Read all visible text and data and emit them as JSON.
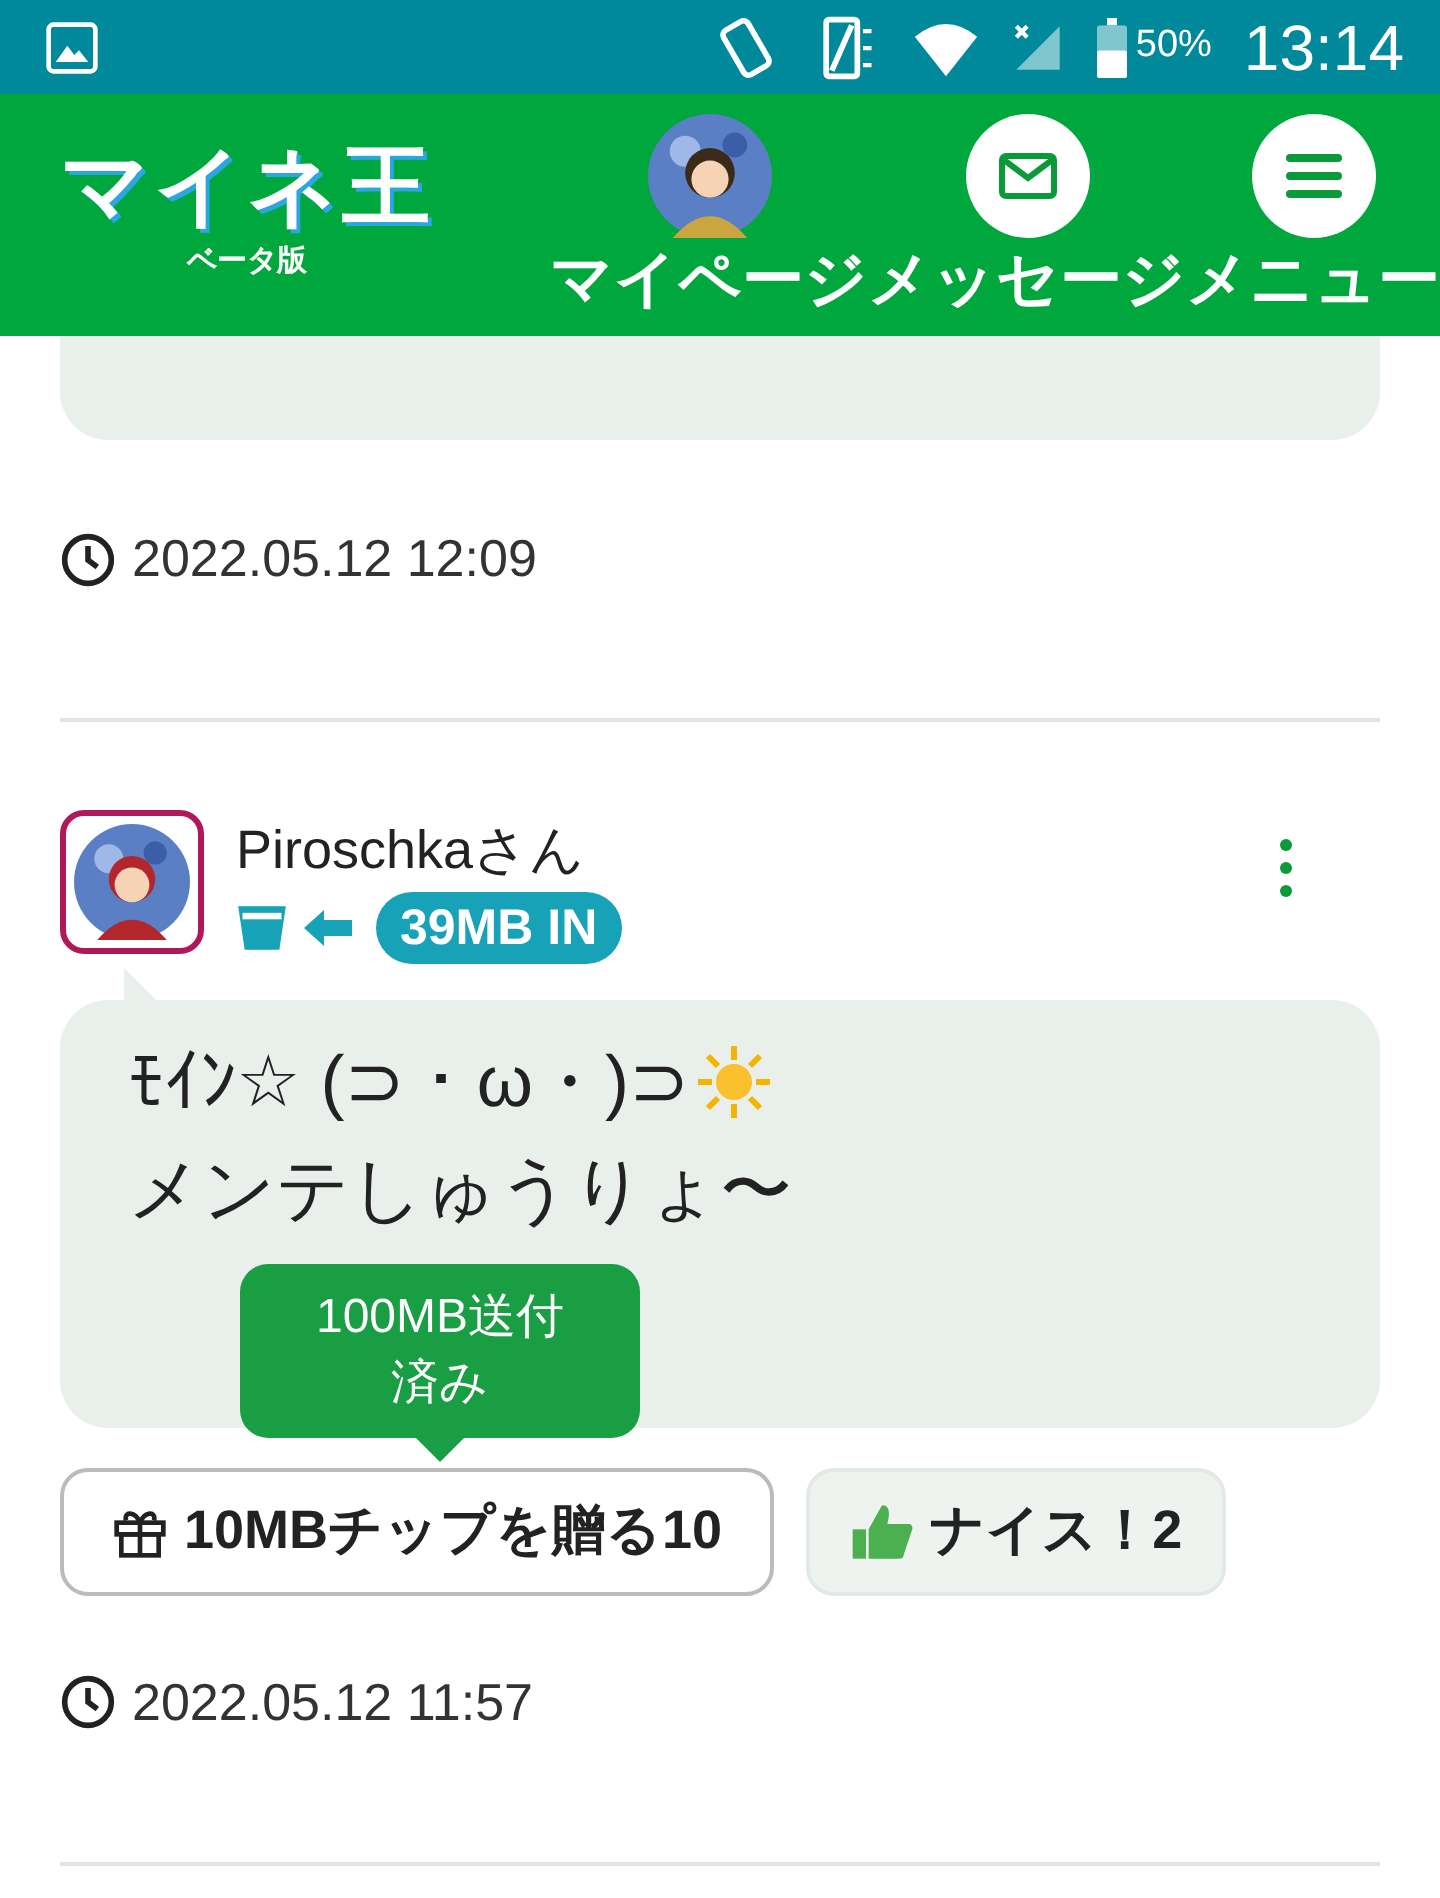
{
  "status_bar": {
    "time": "13:14",
    "battery": "50%"
  },
  "header": {
    "logo": "マイネ王",
    "logo_sub": "ベータ版",
    "nav": [
      {
        "kind": "avatar",
        "label": "マイページ"
      },
      {
        "kind": "mail",
        "label": "メッセージ"
      },
      {
        "kind": "menu",
        "label": "メニュー"
      }
    ]
  },
  "posts": [
    {
      "kind": "tail",
      "time": "2022.05.12 12:09"
    },
    {
      "kind": "full",
      "author": "Piroschkaさん",
      "transfer": "39MB IN",
      "message_lines": [
        "ﾓｲﾝ☆ (⊃・ω・)⊃",
        "メンテしゅうりょ〜"
      ],
      "tip_button": "10MBチップを贈る10",
      "nice_button": "ナイス！2",
      "tooltip": "100MB送付済み",
      "time": "2022.05.12 11:57"
    }
  ]
}
